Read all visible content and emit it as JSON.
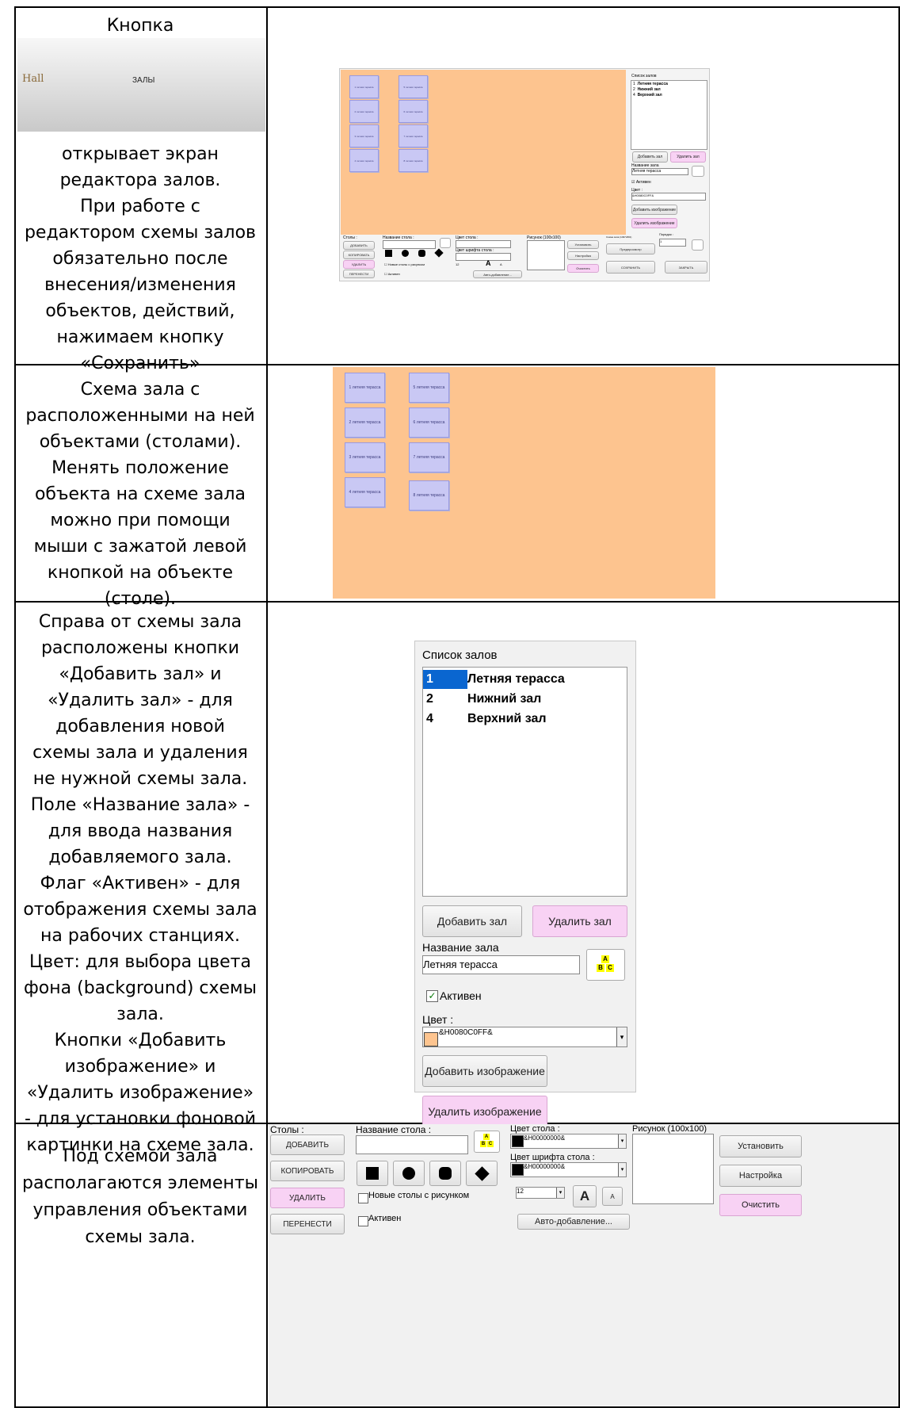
{
  "rows": [
    {
      "description_lines": [
        "Кнопка"
      ],
      "description2": "открывает экран\nредактора залов.\nПри работе с\nредактором схемы залов\nобязательно после\nвнесения/изменения\nобъектов, действий,\nнажимаем кнопку\n«Сохранить»",
      "button_image": {
        "logo": "Hall",
        "label": "ЗАЛЫ"
      }
    },
    {
      "description": "Схема зала с\nрасположенными на ней\nобъектами (столами).\nМенять положение\nобъекта на схеме зала\nможно при помощи\nмыши с зажатой левой\nкнопкой на объекте\n(столе)."
    },
    {
      "description": "Справа от схемы зала\nрасположены кнопки\n«Добавить зал» и\n«Удалить зал» - для\nдобавления новой\nсхемы зала и удаления\nне нужной схемы зала.\nПоле «Название зала» -\nдля ввода названия\nдобавляемого зала.\nФлаг «Активен» - для\nотображения схемы зала\nна рабочих станциях.\nЦвет: для выбора цвета\nфона (background) схемы\nзала.\nКнопки «Добавить\nизображение» и\n«Удалить изображение»\n- для установки фоновой\nкартинки на схеме зала."
    },
    {
      "description": "Под схемой зала\nрасполагаются элементы\nуправления объектами\nсхемы зала."
    }
  ],
  "tables": [
    "1 летняя терасса",
    "2 летняя терасса",
    "3 летняя терасса",
    "4 летняя терасса",
    "5 летняя терасса",
    "6 летняя терасса",
    "7 летняя терасса",
    "8 летняя терасса"
  ],
  "hall_panel": {
    "list_title": "Список залов",
    "halls": [
      {
        "num": "1",
        "name": "Летняя терасса"
      },
      {
        "num": "2",
        "name": "Нижний зал"
      },
      {
        "num": "4",
        "name": "Верхний зал"
      }
    ],
    "add_hall": "Добавить зал",
    "delete_hall": "Удалить зал",
    "name_label": "Название зала",
    "name_value": "Летняя терасса",
    "active_label": "Активен",
    "color_label": "Цвет :",
    "color_value": "&H0080C0FF&",
    "add_image": "Добавить изображение",
    "delete_image": "Удалить изображение",
    "abc": [
      "A",
      "B",
      "C"
    ]
  },
  "controls": {
    "tables_label": "Столы :",
    "add": "ДОБАВИТЬ",
    "copy": "КОПИРОВАТЬ",
    "delete": "УДАЛИТЬ",
    "move": "ПЕРЕНЕСТИ",
    "table_name_label": "Название стола :",
    "new_tables_with_image": "Новые столы с рисунком",
    "active": "Активен",
    "table_color_label": "Цвет стола :",
    "table_color_value": "&H00000000&",
    "font_color_label": "Цвет шрифта стола :",
    "font_color_value": "&H00000000&",
    "font_size": "12",
    "font_big": "A",
    "font_small": "A",
    "auto_add": "Авто-добавление...",
    "image_label": "Рисунок (100x100)",
    "set": "Установить",
    "settings": "Настройка",
    "clear": "Очистить",
    "hall_scheme_label": "Схема зала (1497x801)",
    "preview": "Предпросмотр",
    "order_label": "Порядок :",
    "order_value": "1",
    "save": "СОХРАНИТЬ",
    "close": "ЗАКРЫТЬ"
  },
  "colors": {
    "hall_bg": "#fdc48f",
    "table_bg": "#c9c8f4",
    "pink": "#f8d2f4",
    "selected": "#0a66d0"
  }
}
